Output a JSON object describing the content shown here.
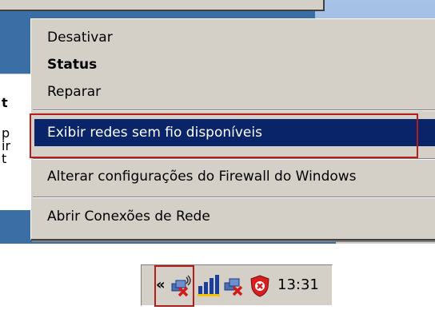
{
  "context_menu": {
    "items": [
      {
        "label": "Desativar",
        "bold": false
      },
      {
        "label": "Status",
        "bold": true
      },
      {
        "label": "Reparar",
        "bold": false
      },
      {
        "label": "Exibir redes sem fio disponíveis",
        "highlighted": true
      },
      {
        "label": "Alterar configurações do Firewall do Windows"
      },
      {
        "label": "Abrir Conexões de Rede"
      }
    ],
    "highlight_color": "#0a246a",
    "annotation_color": "#b11d1d"
  },
  "background_fragments": {
    "doc_letters": [
      "t",
      "p",
      "ir",
      "t"
    ]
  },
  "taskbar_tray": {
    "chevron": "«",
    "icons": [
      "network-disconnected-wireless-icon",
      "wireless-signal-icon",
      "network-disconnected-icon",
      "security-shield-icon"
    ],
    "clock": "13:31"
  }
}
